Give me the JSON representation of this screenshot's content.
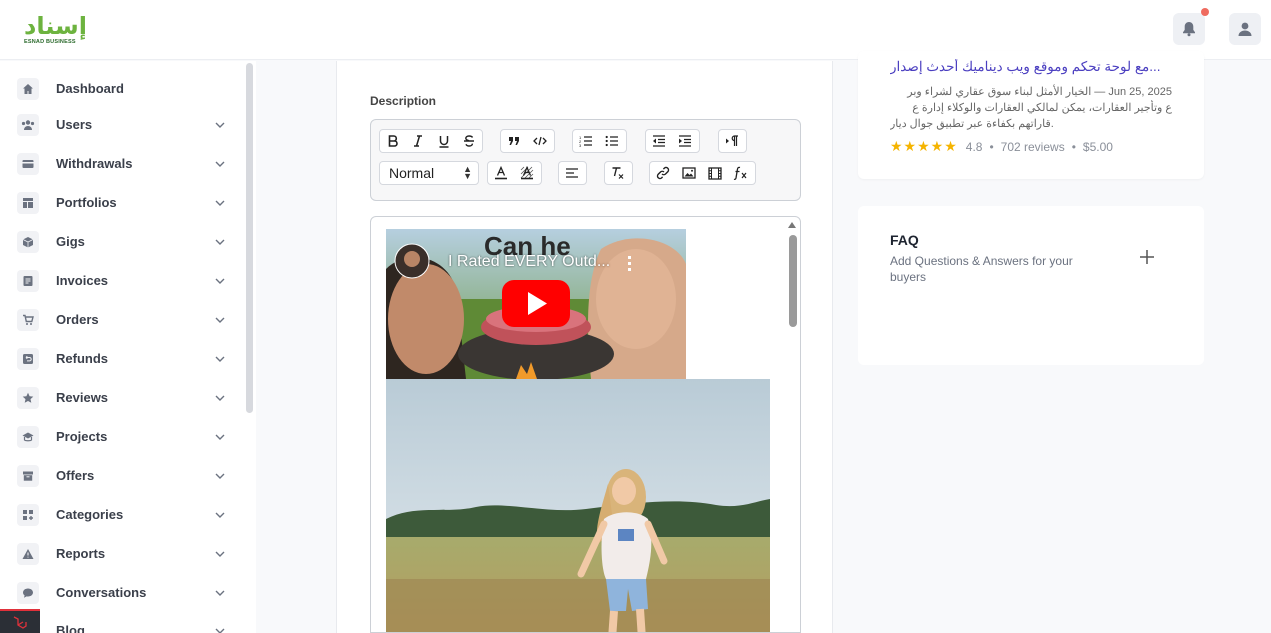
{
  "brand": {
    "logo_text_ar": "إسناد",
    "logo_text_en": "ESNAD BUSINESS"
  },
  "sidebar": {
    "items": [
      {
        "label": "Dashboard",
        "icon": "home-icon",
        "expandable": false
      },
      {
        "label": "Users",
        "icon": "users-icon",
        "expandable": true
      },
      {
        "label": "Withdrawals",
        "icon": "card-icon",
        "expandable": true
      },
      {
        "label": "Portfolios",
        "icon": "layout-icon",
        "expandable": true
      },
      {
        "label": "Gigs",
        "icon": "box-icon",
        "expandable": true
      },
      {
        "label": "Invoices",
        "icon": "invoice-icon",
        "expandable": true
      },
      {
        "label": "Orders",
        "icon": "cart-icon",
        "expandable": true
      },
      {
        "label": "Refunds",
        "icon": "refund-icon",
        "expandable": true
      },
      {
        "label": "Reviews",
        "icon": "star-icon",
        "expandable": true
      },
      {
        "label": "Projects",
        "icon": "projects-icon",
        "expandable": true
      },
      {
        "label": "Offers",
        "icon": "archive-icon",
        "expandable": true
      },
      {
        "label": "Categories",
        "icon": "categories-icon",
        "expandable": true
      },
      {
        "label": "Reports",
        "icon": "warning-icon",
        "expandable": true
      },
      {
        "label": "Conversations",
        "icon": "chat-icon",
        "expandable": true
      },
      {
        "label": "Blog",
        "icon": "blog-icon",
        "expandable": true
      }
    ]
  },
  "editor": {
    "description_label": "Description",
    "format_select": "Normal",
    "video_title": "I Rated EVERY Outd...",
    "video_overlay_text": "Can he Cook?"
  },
  "gig": {
    "title": "...مع لوحة تحكم وموقع ويب ديناميك أحدث إصدار",
    "date_line": "Jun 25, 2025 — الخيار الأمثل لبناء سوق عقاري لشراء وبر",
    "text_line2": "ع وتأجير العقارات، يمكن لمالكي العقارات والوكلاء إدارة ع",
    "text_line3": ".قاراتهم بكفاءة عبر تطبيق جوال ديار",
    "stars": "★★★★★",
    "rating": "4.8",
    "reviews": "702 reviews",
    "price": "$5.00",
    "sep": "•"
  },
  "faq": {
    "title": "FAQ",
    "subtitle": "Add Questions & Answers for your buyers"
  },
  "colors": {
    "accent": "#4a3ec0",
    "brand_green": "#6db33f",
    "star": "#f5b400",
    "notify": "#ef6b5f"
  }
}
